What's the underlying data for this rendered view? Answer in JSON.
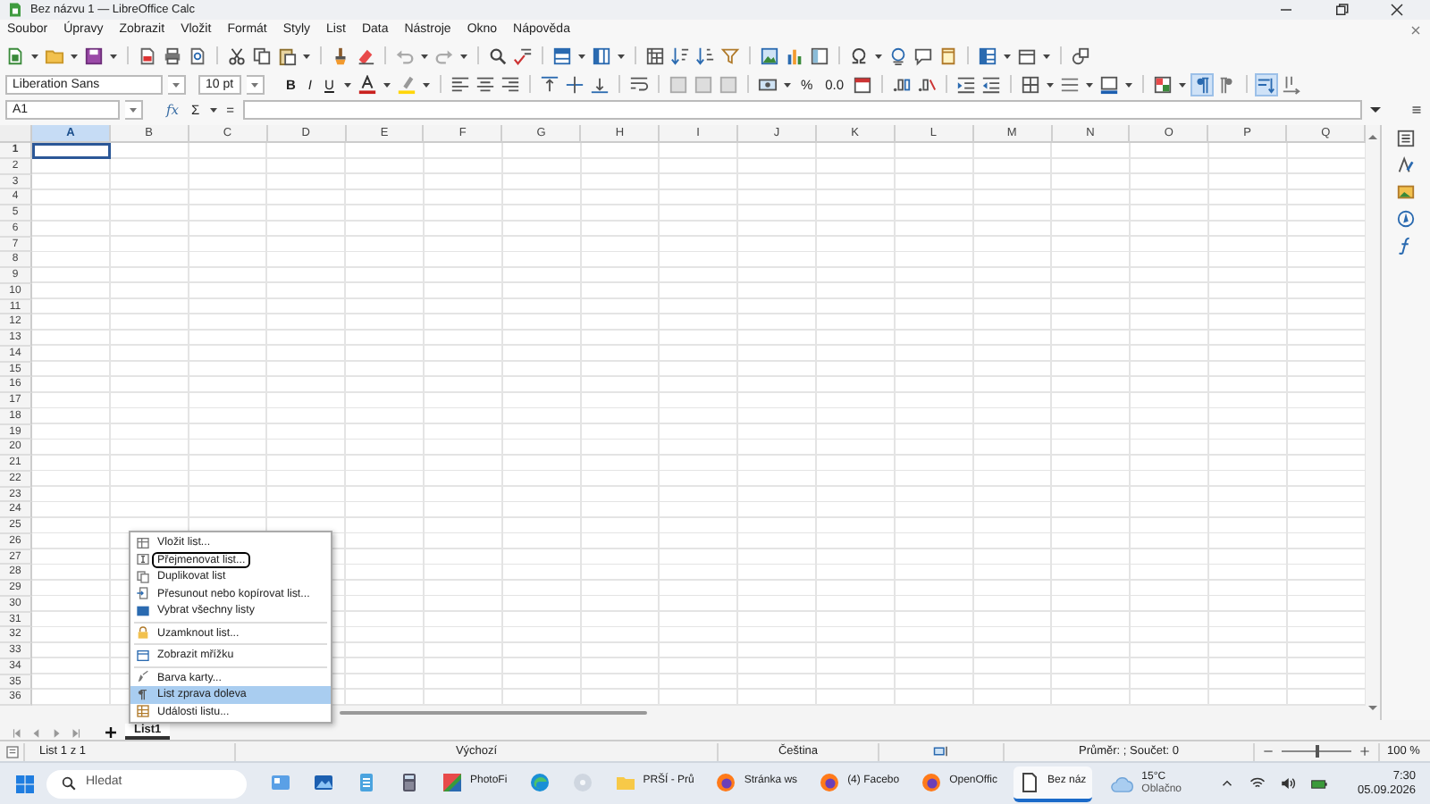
{
  "window": {
    "title": "Bez názvu 1 — LibreOffice Calc"
  },
  "menu": [
    "Soubor",
    "Úpravy",
    "Zobrazit",
    "Vložit",
    "Formát",
    "Styly",
    "List",
    "Data",
    "Nástroje",
    "Okno",
    "Nápověda"
  ],
  "formatting": {
    "font_name": "Liberation Sans",
    "font_size": "10 pt",
    "style_buttons": [
      "B",
      "I",
      "U"
    ],
    "number_buttons": [
      "%",
      "0.0"
    ]
  },
  "text_direction": {
    "ltr_selected": true,
    "rtl_selected": false,
    "horizontal_selected": true,
    "vertical_selected": false
  },
  "formula_bar": {
    "name_box": "A1",
    "function_wizard": "fx",
    "sum": "Σ",
    "equals": "="
  },
  "sheet": {
    "columns": [
      {
        "label": "A",
        "selected": true
      },
      {
        "label": "B",
        "selected": false
      },
      {
        "label": "C",
        "selected": false
      },
      {
        "label": "D",
        "selected": false
      },
      {
        "label": "E",
        "selected": false
      },
      {
        "label": "F",
        "selected": false
      },
      {
        "label": "G",
        "selected": false
      },
      {
        "label": "H",
        "selected": false
      },
      {
        "label": "I",
        "selected": false
      },
      {
        "label": "J",
        "selected": false
      },
      {
        "label": "K",
        "selected": false
      },
      {
        "label": "L",
        "selected": false
      },
      {
        "label": "M",
        "selected": false
      },
      {
        "label": "N",
        "selected": false
      },
      {
        "label": "O",
        "selected": false
      },
      {
        "label": "P",
        "selected": false
      },
      {
        "label": "Q",
        "selected": false
      }
    ],
    "rows": [
      {
        "label": "1",
        "selected": true
      },
      {
        "label": "2",
        "selected": false
      },
      {
        "label": "3",
        "selected": false
      },
      {
        "label": "4",
        "selected": false
      },
      {
        "label": "5",
        "selected": false
      },
      {
        "label": "6",
        "selected": false
      },
      {
        "label": "7",
        "selected": false
      },
      {
        "label": "8",
        "selected": false
      },
      {
        "label": "9",
        "selected": false
      },
      {
        "label": "10",
        "selected": false
      },
      {
        "label": "11",
        "selected": false
      },
      {
        "label": "12",
        "selected": false
      },
      {
        "label": "13",
        "selected": false
      },
      {
        "label": "14",
        "selected": false
      },
      {
        "label": "15",
        "selected": false
      },
      {
        "label": "16",
        "selected": false
      },
      {
        "label": "17",
        "selected": false
      },
      {
        "label": "18",
        "selected": false
      },
      {
        "label": "19",
        "selected": false
      },
      {
        "label": "20",
        "selected": false
      },
      {
        "label": "21",
        "selected": false
      },
      {
        "label": "22",
        "selected": false
      },
      {
        "label": "23",
        "selected": false
      },
      {
        "label": "24",
        "selected": false
      },
      {
        "label": "25",
        "selected": false
      },
      {
        "label": "26",
        "selected": false
      },
      {
        "label": "27",
        "selected": false
      },
      {
        "label": "28",
        "selected": false
      },
      {
        "label": "29",
        "selected": false
      },
      {
        "label": "30",
        "selected": false
      },
      {
        "label": "31",
        "selected": false
      },
      {
        "label": "32",
        "selected": false
      },
      {
        "label": "33",
        "selected": false
      },
      {
        "label": "34",
        "selected": false
      },
      {
        "label": "35",
        "selected": false
      },
      {
        "label": "36",
        "selected": false
      }
    ]
  },
  "context_menu": {
    "items": [
      {
        "label": "Vložit list...",
        "selected": false,
        "focused": false,
        "separator_after": false
      },
      {
        "label": "Přejmenovat list...",
        "selected": false,
        "focused": true,
        "separator_after": false
      },
      {
        "label": "Duplikovat list",
        "selected": false,
        "focused": false,
        "separator_after": false
      },
      {
        "label": "Přesunout nebo kopírovat list...",
        "selected": false,
        "focused": false,
        "separator_after": false
      },
      {
        "label": "Vybrat všechny listy",
        "selected": false,
        "focused": false,
        "separator_after": true
      },
      {
        "label": "Uzamknout list...",
        "selected": false,
        "focused": false,
        "separator_after": true
      },
      {
        "label": "Zobrazit mřížku",
        "selected": false,
        "focused": false,
        "separator_after": true
      },
      {
        "label": "Barva karty...",
        "selected": false,
        "focused": false,
        "separator_after": false
      },
      {
        "label": "List zprava doleva",
        "selected": true,
        "focused": false,
        "separator_after": false
      },
      {
        "label": "Události listu...",
        "selected": false,
        "focused": false,
        "separator_after": false
      }
    ]
  },
  "sheet_tabs": [
    {
      "label": "List1",
      "selected": true
    }
  ],
  "status_bar": {
    "sheet": "List 1 z 1",
    "page_style": "Výchozí",
    "language": "Čeština",
    "summary": "Průměr: ; Součet: 0",
    "zoom_slider": {
      "level": 0.5
    },
    "zoom": "100 %"
  },
  "taskbar": {
    "search_placeholder": "Hledat",
    "apps": [
      {
        "kind": "widgets",
        "selected": false
      },
      {
        "kind": "photos",
        "selected": false
      },
      {
        "kind": "notepad",
        "selected": false
      },
      {
        "kind": "calculator",
        "selected": false
      },
      {
        "kind": "photo-editor",
        "label": "PhotoFi",
        "selected": false
      },
      {
        "kind": "edge",
        "selected": false
      },
      {
        "kind": "disc",
        "selected": false
      },
      {
        "kind": "folder",
        "label": "PRŠÍ - Prů",
        "selected": false
      },
      {
        "kind": "firefox",
        "label": "Stránka ws",
        "selected": false
      },
      {
        "kind": "firefox",
        "label": "(4) Facebo",
        "selected": false
      },
      {
        "kind": "firefox",
        "label": "OpenOffic",
        "selected": false
      },
      {
        "kind": "document",
        "label": "Bez náz",
        "selected": true
      }
    ],
    "weather": {
      "temperature": "15°C",
      "condition": "Oblačno"
    },
    "clock": {
      "time": "7:30",
      "date": "05.09.2026"
    }
  }
}
